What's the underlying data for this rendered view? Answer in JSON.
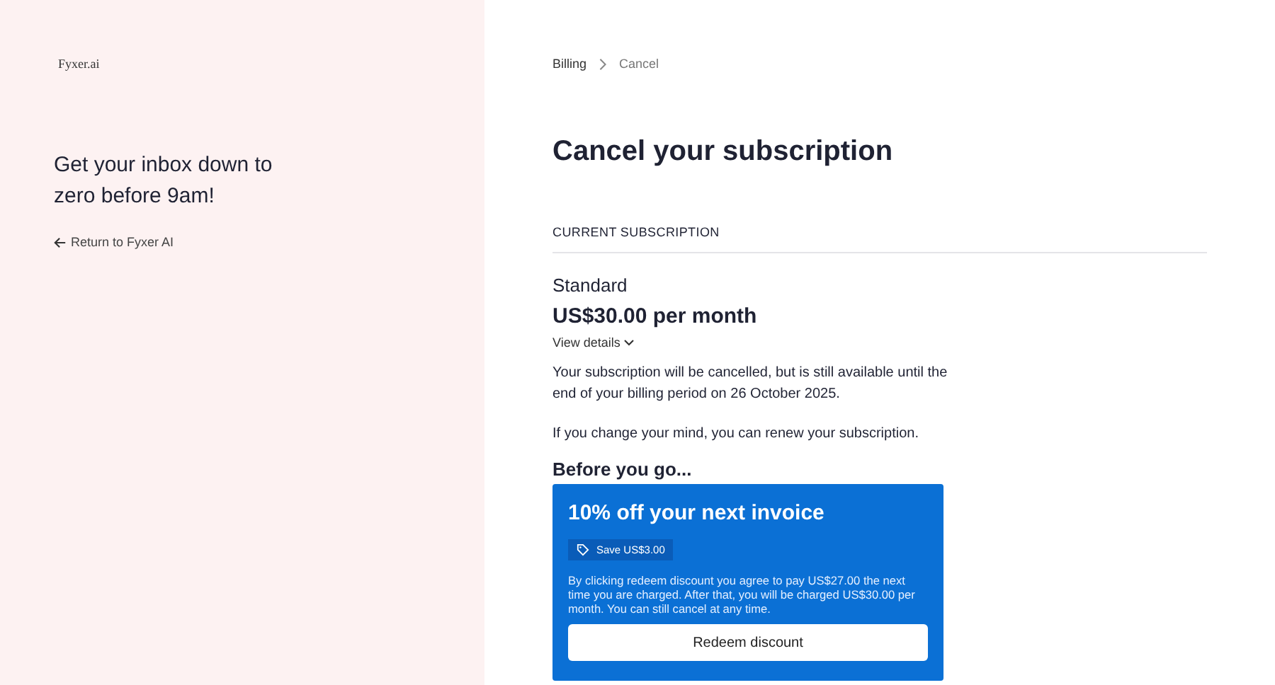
{
  "logo": "Fyxer.ai",
  "tagline": "Get your inbox down to zero before 9am!",
  "return_link": "Return to Fyxer AI",
  "breadcrumb": [
    {
      "label": "Billing",
      "selected": false
    },
    {
      "label": "Cancel",
      "selected": true
    }
  ],
  "title": "Cancel your subscription",
  "section_label": "CURRENT SUBSCRIPTION",
  "plan": {
    "name": "Standard",
    "price": "US$30.00 per month",
    "details_link": "View details"
  },
  "notice": "Your subscription will be cancelled, but is still available until the end of your billing period on 26 October 2025.",
  "renew_note": "If you change your mind, you can renew your subscription.",
  "offer_heading": "Before you go...",
  "offer": {
    "title": "10% off your next invoice",
    "badge": "Save US$3.00",
    "terms": "By clicking redeem discount you agree to pay US$27.00 the next time you are charged. After that, you will be charged US$30.00 per month. You can still cancel at any time.",
    "button": "Redeem discount"
  }
}
